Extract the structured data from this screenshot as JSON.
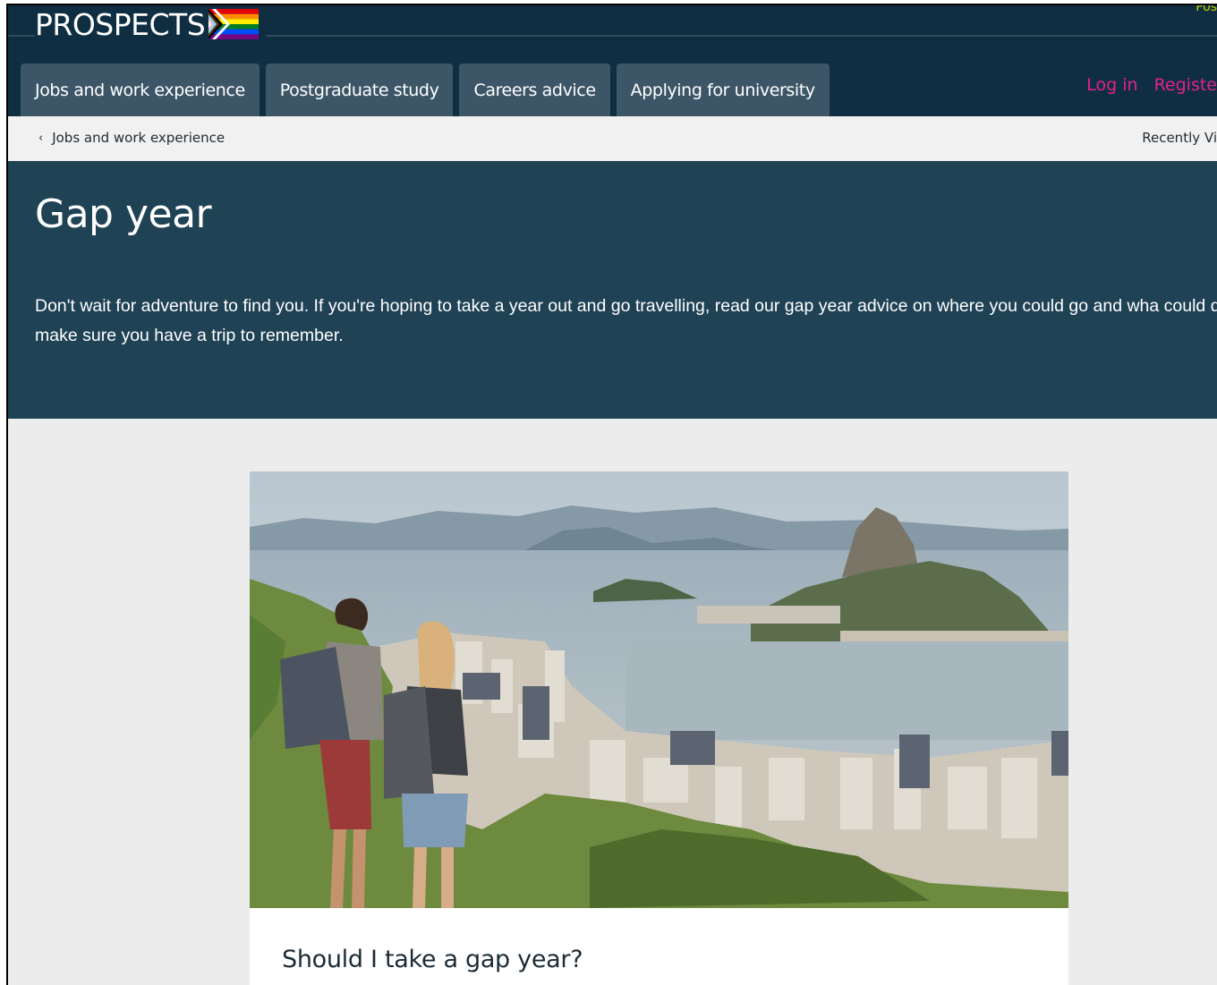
{
  "brand": {
    "name": "PROSPECTS"
  },
  "header": {
    "top_right_snippet": "Pos",
    "nav": [
      {
        "label": "Jobs and work experience"
      },
      {
        "label": "Postgraduate study"
      },
      {
        "label": "Careers advice"
      },
      {
        "label": "Applying for university"
      }
    ],
    "login_label": "Log in",
    "register_label": "Registe"
  },
  "breadcrumb": {
    "back_label": "Jobs and work experience",
    "recently_viewed": "Recently Vi"
  },
  "hero": {
    "title": "Gap year",
    "intro": "Don't wait for adventure to find you. If you're hoping to take a year out and go travelling, read our gap year advice on where you could go and wha could do to make sure you have a trip to remember."
  },
  "article": {
    "image_subject": "Two backpackers looking over Rio de Janeiro and Sugarloaf Mountain",
    "section_heading": "Should I take a gap year?"
  },
  "colors": {
    "header_bg": "#0f2e42",
    "hero_bg": "#1f4255",
    "accent_pink": "#e2218c",
    "tab_bg": "#3d5667"
  }
}
